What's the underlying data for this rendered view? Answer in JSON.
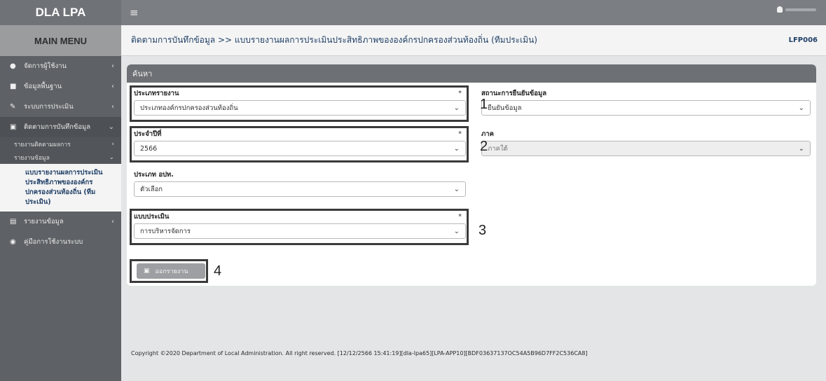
{
  "app": {
    "brand": "DLA LPA",
    "menu_header": "MAIN MENU",
    "hamburger_icon": "≡",
    "user_icon": "user-icon"
  },
  "sidebar": {
    "items": [
      {
        "icon": "user-icon",
        "label": "จัดการผู้ใช้งาน"
      },
      {
        "icon": "database-icon",
        "label": "ข้อมูลพื้นฐาน"
      },
      {
        "icon": "edit-icon",
        "label": "ระบบการประเมิน"
      },
      {
        "icon": "file-icon",
        "label": "ติดตามการบันทึกข้อมูล"
      }
    ],
    "subitems": [
      {
        "label": "รายงานติดตามผลการ"
      },
      {
        "label": "รายงานข้อมูล"
      }
    ],
    "active_leaf": "แบบรายงานผลการประเมินประสิทธิภาพขององค์กรปกครองส่วนท้องถิ่น (ทีมประเมิน)",
    "items_after": [
      {
        "icon": "chart-icon",
        "label": "รายงานข้อมูล"
      },
      {
        "icon": "globe-icon",
        "label": "คู่มือการใช้งานระบบ"
      }
    ]
  },
  "main": {
    "breadcrumb": "ติดตามการบันทึกข้อมูล >>  แบบรายงานผลการประเมินประสิทธิภาพขององค์กรปกครองส่วนท้องถิ่น (ทีมประเมิน)",
    "page_code": "LFP006",
    "panel_title": "ค้นหา",
    "fields": {
      "report_type": {
        "label": "ประเภทรายงาน",
        "required": "*",
        "value": "ประเภทองค์กรปกครองส่วนท้องถิ่น"
      },
      "confirm_status": {
        "label": "สถานะการยืนยันข้อมูล",
        "value": "ยืนยันข้อมูล"
      },
      "fiscal_year": {
        "label": "ประจำปีที่",
        "required": "*",
        "value": "2566"
      },
      "region": {
        "label": "ภาค",
        "value": "ภาคใต้"
      },
      "org_type": {
        "label": "ประเภท อปท.",
        "value": "ตัวเลือก"
      },
      "assessment_form": {
        "label": "แบบประเมิน",
        "required": "*",
        "value": "การบริหารจัดการ"
      }
    },
    "report_button": "ออกรายงาน",
    "steps": [
      "1",
      "2",
      "3",
      "4"
    ],
    "footer": "Copyright ©2020 Department of Local Administration. All right reserved. [12/12/2566 15:41:19][dla-lpa65][LPA-APP10][BDF03637137OC54A5B96D7FF2C536CA8]"
  }
}
